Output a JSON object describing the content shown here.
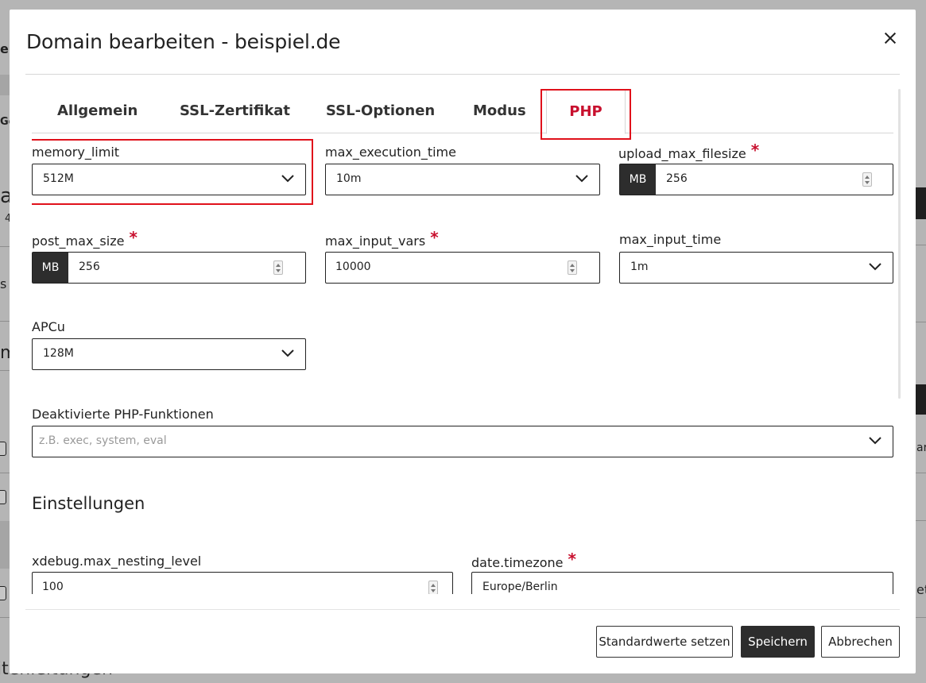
{
  "background": {
    "fragments": [
      "en",
      "Go",
      "a",
      "4",
      "s v",
      "m",
      "ar",
      "et",
      "itenleitungen"
    ]
  },
  "modal": {
    "title": "Domain bearbeiten - beispiel.de",
    "tabs": [
      {
        "label": "Allgemein",
        "active": false
      },
      {
        "label": "SSL-Zertifikat",
        "active": false
      },
      {
        "label": "SSL-Optionen",
        "active": false
      },
      {
        "label": "Modus",
        "active": false
      },
      {
        "label": "PHP",
        "active": true
      }
    ],
    "fields": {
      "memory_limit": {
        "label": "memory_limit",
        "value": "512M"
      },
      "max_execution_time": {
        "label": "max_execution_time",
        "value": "10m"
      },
      "upload_max_filesize": {
        "label": "upload_max_filesize",
        "unit": "MB",
        "value": "256",
        "required": "*"
      },
      "post_max_size": {
        "label": "post_max_size",
        "unit": "MB",
        "value": "256",
        "required": "*"
      },
      "max_input_vars": {
        "label": "max_input_vars",
        "value": "10000",
        "required": "*"
      },
      "max_input_time": {
        "label": "max_input_time",
        "value": "1m"
      },
      "apcu": {
        "label": "APCu",
        "value": "128M"
      },
      "disabled_functions": {
        "label": "Deaktivierte PHP-Funktionen",
        "placeholder": "z.B. exec, system, eval"
      },
      "xdebug": {
        "label": "xdebug.max_nesting_level",
        "value": "100"
      },
      "timezone": {
        "label": "date.timezone",
        "value": "Europe/Berlin",
        "required": "*"
      }
    },
    "settings_title": "Einstellungen",
    "buttons": {
      "defaults": "Standardwerte setzen",
      "save": "Speichern",
      "cancel": "Abbrechen"
    },
    "colors": {
      "accent": "#c8102e",
      "highlight": "#e0111b",
      "dark": "#2d2d2d"
    }
  }
}
